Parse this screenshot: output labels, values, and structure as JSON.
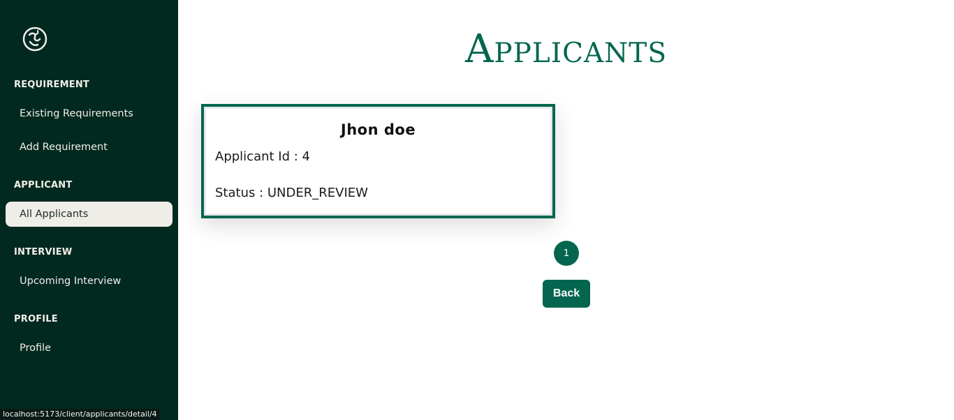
{
  "sidebar": {
    "logo_icon": "globe-leaf-logo",
    "sections": [
      {
        "heading": "REQUIREMENT",
        "items": [
          "Existing Requirements",
          "Add Requirement"
        ]
      },
      {
        "heading": "APPLICANT",
        "items": [
          "All Applicants"
        ]
      },
      {
        "heading": "INTERVIEW",
        "items": [
          "Upcoming Interview"
        ]
      },
      {
        "heading": "PROFILE",
        "items": [
          "Profile"
        ]
      }
    ],
    "active_item": "All Applicants"
  },
  "main": {
    "title": "Applicants",
    "card": {
      "name": "Jhon doe",
      "applicant_id": "Applicant Id : 4",
      "status": "Status : UNDER_REVIEW"
    },
    "pagination": {
      "current_page": "1"
    },
    "back_label": "Back"
  },
  "status_bar": {
    "url": "localhost:5173/client/applicants/detail/4"
  },
  "colors": {
    "sidebar_bg": "#022920",
    "accent": "#04664f",
    "active_item_bg": "#eeede7"
  }
}
